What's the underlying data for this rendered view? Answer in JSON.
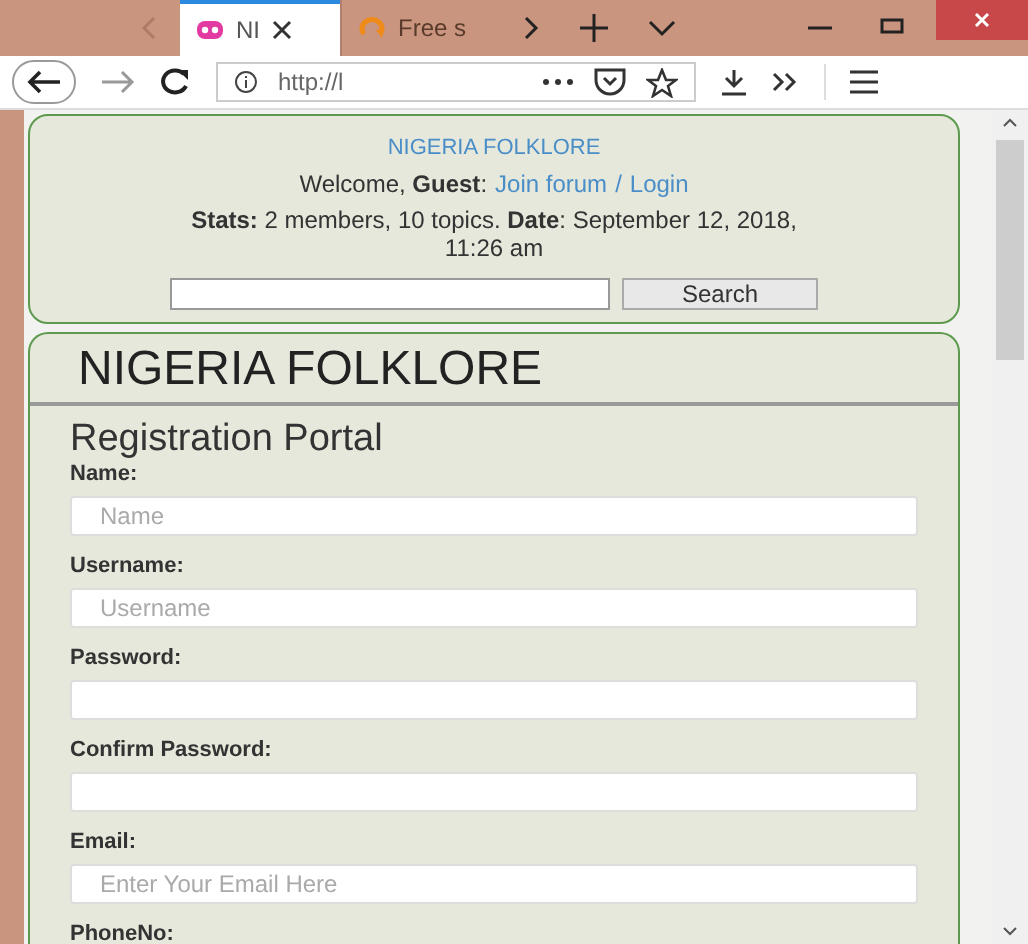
{
  "browser": {
    "tabs": [
      {
        "title": "NI",
        "selected": true
      },
      {
        "title": "Free s",
        "selected": false
      }
    ],
    "url": "http://l"
  },
  "header": {
    "site_title": "NIGERIA FOLKLORE",
    "welcome": "Welcome, **Guest**:",
    "links": [
      "Join forum",
      "Login"
    ],
    "separator": "/",
    "stats": "**Stats:** 2 members, 10 topics. **Date**: September 12, 2018, 11:26 am",
    "search_button": "Search"
  },
  "main": {
    "title": "NIGERIA FOLKLORE",
    "subtitle": "Registration Portal",
    "fields": [
      {
        "label": "Name:",
        "placeholder": "Name"
      },
      {
        "label": "Username:",
        "placeholder": "Username"
      },
      {
        "label": "Password:"
      },
      {
        "label": "Confirm Password:"
      },
      {
        "label": "Email:",
        "placeholder": "Enter Your Email Here"
      },
      {
        "label": "PhoneNo:"
      }
    ]
  }
}
